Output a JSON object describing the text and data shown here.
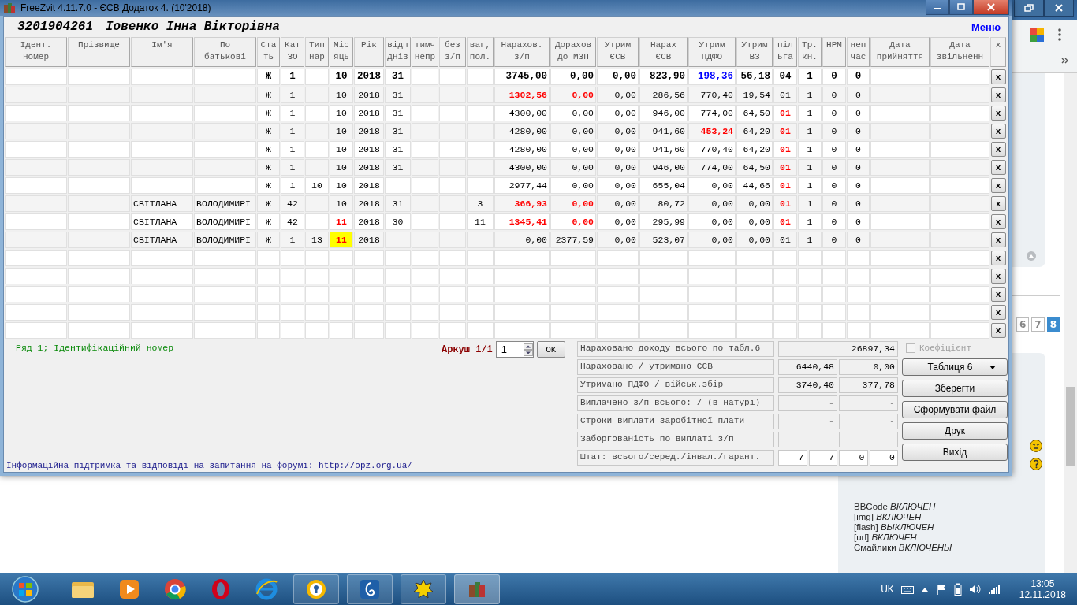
{
  "window": {
    "title": "FreeZvit 4.11.7.0 - ЄСВ Додаток 4. (10'2018)"
  },
  "header": {
    "code": "3201904261",
    "name": "Іовенко Інна Вікторівна",
    "menu": "Меню"
  },
  "table": {
    "columns": [
      "Ідент.\nномер",
      "Прізвище",
      "Ім'я",
      "По\nбатькові",
      "Ста\nть",
      "Кат\nЗО",
      "Тип\nнар",
      "Міс\nяць",
      "Рік",
      "відп\nднів",
      "тимч\nнепр",
      "без\nз/п",
      "ваг,\nпол.",
      "Нарахов.\nз/п",
      "Дорахов\nдо МЗП",
      "Утрим\nЄСВ",
      "Нарах\nЄСВ",
      "Утрим\nПДФО",
      "Утрим\nВЗ",
      "піл\nьга",
      "Тр.\nкн.",
      "НРМ",
      "неп\nчас",
      "Дата\nприйняття",
      "Дата\nзвільненн",
      "x"
    ],
    "rows": [
      {
        "selected": true,
        "delete_button": "x",
        "cells": [
          null,
          null,
          null,
          null,
          "Ж",
          "1",
          null,
          "10",
          "2018",
          "31",
          null,
          null,
          null,
          "3745,00",
          "0,00",
          "0,00",
          "823,90",
          {
            "text": "198,36",
            "color": "#0000ff"
          },
          "56,18",
          "04",
          "1",
          "0",
          "0",
          null,
          null
        ]
      },
      {
        "selected": false,
        "delete_button": "x",
        "cells": [
          null,
          null,
          null,
          null,
          "Ж",
          "1",
          null,
          "10",
          "2018",
          "31",
          null,
          null,
          null,
          {
            "text": "1302,56",
            "color": "#ff0000"
          },
          {
            "text": "0,00",
            "color": "#ff0000"
          },
          "0,00",
          "286,56",
          "770,40",
          "19,54",
          "01",
          "1",
          "0",
          "0",
          null,
          null
        ]
      },
      {
        "selected": false,
        "delete_button": "x",
        "cells": [
          null,
          null,
          null,
          null,
          "Ж",
          "1",
          null,
          "10",
          "2018",
          "31",
          null,
          null,
          null,
          "4300,00",
          "0,00",
          "0,00",
          "946,00",
          "774,00",
          "64,50",
          {
            "text": "01",
            "color": "#ff0000"
          },
          "1",
          "0",
          "0",
          null,
          null
        ]
      },
      {
        "selected": false,
        "delete_button": "x",
        "cells": [
          null,
          null,
          null,
          null,
          "Ж",
          "1",
          null,
          "10",
          "2018",
          "31",
          null,
          null,
          null,
          "4280,00",
          "0,00",
          "0,00",
          "941,60",
          {
            "text": "453,24",
            "color": "#ff0000"
          },
          "64,20",
          {
            "text": "01",
            "color": "#ff0000"
          },
          "1",
          "0",
          "0",
          null,
          null
        ]
      },
      {
        "selected": false,
        "delete_button": "x",
        "cells": [
          null,
          null,
          null,
          null,
          "Ж",
          "1",
          null,
          "10",
          "2018",
          "31",
          null,
          null,
          null,
          "4280,00",
          "0,00",
          "0,00",
          "941,60",
          "770,40",
          "64,20",
          {
            "text": "01",
            "color": "#ff0000"
          },
          "1",
          "0",
          "0",
          null,
          null
        ]
      },
      {
        "selected": false,
        "delete_button": "x",
        "cells": [
          null,
          null,
          null,
          null,
          "Ж",
          "1",
          null,
          "10",
          "2018",
          "31",
          null,
          null,
          null,
          "4300,00",
          "0,00",
          "0,00",
          "946,00",
          "774,00",
          "64,50",
          {
            "text": "01",
            "color": "#ff0000"
          },
          "1",
          "0",
          "0",
          null,
          null
        ]
      },
      {
        "selected": false,
        "delete_button": "x",
        "cells": [
          null,
          null,
          null,
          null,
          "Ж",
          "1",
          "10",
          "10",
          "2018",
          null,
          null,
          null,
          null,
          "2977,44",
          "0,00",
          "0,00",
          "655,04",
          "0,00",
          "44,66",
          {
            "text": "01",
            "color": "#ff0000"
          },
          "1",
          "0",
          "0",
          null,
          null
        ]
      },
      {
        "selected": false,
        "delete_button": "x",
        "cells": [
          null,
          null,
          "СВІТЛАНА",
          "ВОЛОДИМИРІ",
          "Ж",
          "42",
          null,
          "10",
          "2018",
          "31",
          null,
          null,
          "3",
          {
            "text": "366,93",
            "color": "#ff0000"
          },
          {
            "text": "0,00",
            "color": "#ff0000"
          },
          "0,00",
          "80,72",
          "0,00",
          "0,00",
          {
            "text": "01",
            "color": "#ff0000"
          },
          "1",
          "0",
          "0",
          null,
          null
        ]
      },
      {
        "selected": false,
        "delete_button": "x",
        "cells": [
          null,
          null,
          "СВІТЛАНА",
          "ВОЛОДИМИРІ",
          "Ж",
          "42",
          null,
          {
            "text": "11",
            "color": "#ff0000"
          },
          "2018",
          "30",
          null,
          null,
          "11",
          {
            "text": "1345,41",
            "color": "#ff0000"
          },
          {
            "text": "0,00",
            "color": "#ff0000"
          },
          "0,00",
          "295,99",
          "0,00",
          "0,00",
          {
            "text": "01",
            "color": "#ff0000"
          },
          "1",
          "0",
          "0",
          null,
          null
        ]
      },
      {
        "selected": false,
        "delete_button": "x",
        "cells": [
          null,
          null,
          "СВІТЛАНА",
          "ВОЛОДИМИРІ",
          "Ж",
          "1",
          "13",
          {
            "text": "11",
            "color": "#ff0000",
            "highlighted": true
          },
          "2018",
          null,
          null,
          null,
          null,
          "0,00",
          "2377,59",
          "0,00",
          "523,07",
          "0,00",
          "0,00",
          "01",
          "1",
          "0",
          "0",
          null,
          null
        ]
      }
    ],
    "blank_rows": [
      {
        "delete_button": "x"
      },
      {
        "delete_button": "x"
      },
      {
        "delete_button": "x"
      },
      {
        "delete_button": "x"
      },
      {
        "delete_button": "x"
      }
    ]
  },
  "status": "Ряд 1; Ідентифікаційний номер",
  "sheet": {
    "label": "Аркуш 1/1",
    "value": "1",
    "ok": "ОК"
  },
  "summary": [
    {
      "label": "Нараховано доходу всього по табл.6",
      "values": [
        "26897,34"
      ]
    },
    {
      "label": "Нараховано / утримано ЄСВ",
      "values": [
        "6440,48",
        "0,00"
      ]
    },
    {
      "label": "Утримано ПДФО / військ.збір",
      "values": [
        "3740,40",
        "377,78"
      ]
    },
    {
      "label": "Виплачено з/п всього: / (в натурі)",
      "values": [
        "-",
        "-"
      ]
    },
    {
      "label": "Строки виплати заробітної плати",
      "values": [
        "-",
        "-"
      ]
    },
    {
      "label": "Заборгованість по виплаті з/п",
      "values": [
        "-",
        "-"
      ]
    },
    {
      "label": "Штат: всього/серед./інвал./гарант.",
      "values": [
        "7",
        "7",
        "0",
        "0"
      ]
    }
  ],
  "coefficient": {
    "label": "Коефіцієнт",
    "checked": false,
    "disabled": true
  },
  "table_select": "Таблиця 6",
  "buttons": [
    "Зберегти",
    "Сформувати файл",
    "Друк",
    "Вихід"
  ],
  "footer": {
    "text": "Інформаційна підтримка та відповіді на запитання на форумі:",
    "link": "http://opz.org.ua/"
  },
  "browser": {
    "pages": [
      {
        "label": "6",
        "selected": false
      },
      {
        "label": "7",
        "selected": false
      },
      {
        "label": "8",
        "selected": true
      }
    ],
    "editor_options": [
      "BBCode *ВКЛЮЧЕН*",
      "[img] *ВКЛЮЧЕН*",
      "[flash] *ВЫКЛЮЧЕН*",
      "[url] *ВКЛЮЧЕН*",
      "Смайлики *ВКЛЮЧЕНЫ*"
    ]
  },
  "taskbar": {
    "language": "UK",
    "time": "13:05",
    "date": "12.11.2018"
  }
}
